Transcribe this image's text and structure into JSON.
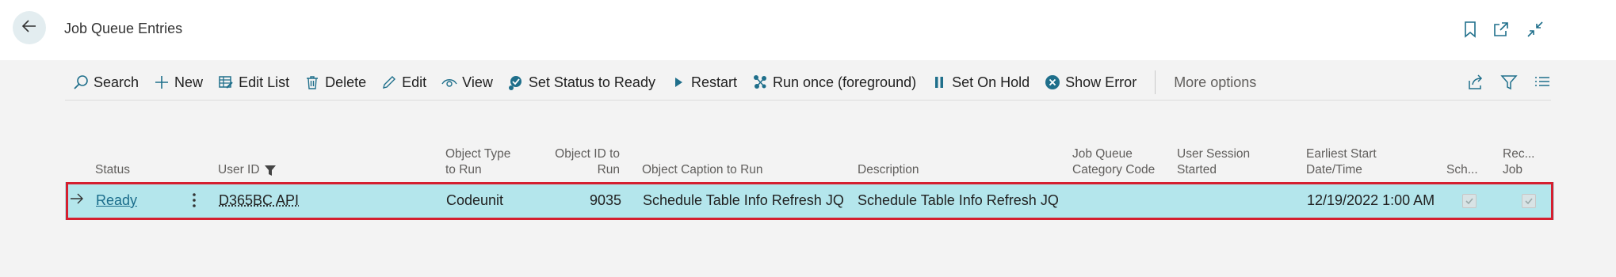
{
  "header": {
    "title": "Job Queue Entries"
  },
  "actions": [
    {
      "id": "search",
      "label": "Search",
      "icon": "search-icon"
    },
    {
      "id": "new",
      "label": "New",
      "icon": "plus-icon"
    },
    {
      "id": "edit_list",
      "label": "Edit List",
      "icon": "edit-list-icon"
    },
    {
      "id": "delete",
      "label": "Delete",
      "icon": "trash-icon"
    },
    {
      "id": "edit",
      "label": "Edit",
      "icon": "pencil-icon"
    },
    {
      "id": "view",
      "label": "View",
      "icon": "eye-icon"
    },
    {
      "id": "set_status_ready",
      "label": "Set Status to Ready",
      "icon": "status-ready-icon"
    },
    {
      "id": "restart",
      "label": "Restart",
      "icon": "play-icon"
    },
    {
      "id": "run_once",
      "label": "Run once (foreground)",
      "icon": "run-icon"
    },
    {
      "id": "set_on_hold",
      "label": "Set On Hold",
      "icon": "pause-icon"
    },
    {
      "id": "show_error",
      "label": "Show Error",
      "icon": "error-icon"
    }
  ],
  "more_options": "More options",
  "columns": {
    "status": "Status",
    "user_id": "User ID",
    "object_type": [
      "Object Type",
      "to Run"
    ],
    "object_id": [
      "Object ID to",
      "Run"
    ],
    "object_caption": "Object Caption to Run",
    "description": "Description",
    "category_code": [
      "Job Queue",
      "Category Code"
    ],
    "user_session": [
      "User Session",
      "Started"
    ],
    "earliest_start": [
      "Earliest Start",
      "Date/Time"
    ],
    "scheduled": "Sch...",
    "recurring": [
      "Rec...",
      "Job"
    ]
  },
  "rows": [
    {
      "status": "Ready",
      "user_id": "D365BC API",
      "object_type": "Codeunit",
      "object_id": "9035",
      "object_caption": "Schedule Table Info Refresh JQ",
      "description": "Schedule Table Info Refresh JQ",
      "category_code": "",
      "user_session": "",
      "earliest_start": "12/19/2022 1:00 AM",
      "scheduled": true,
      "recurring": true
    }
  ],
  "colors": {
    "accent": "#1f6f8b",
    "row_selected": "#b4e6ec",
    "highlight_border": "#d51f2f"
  }
}
